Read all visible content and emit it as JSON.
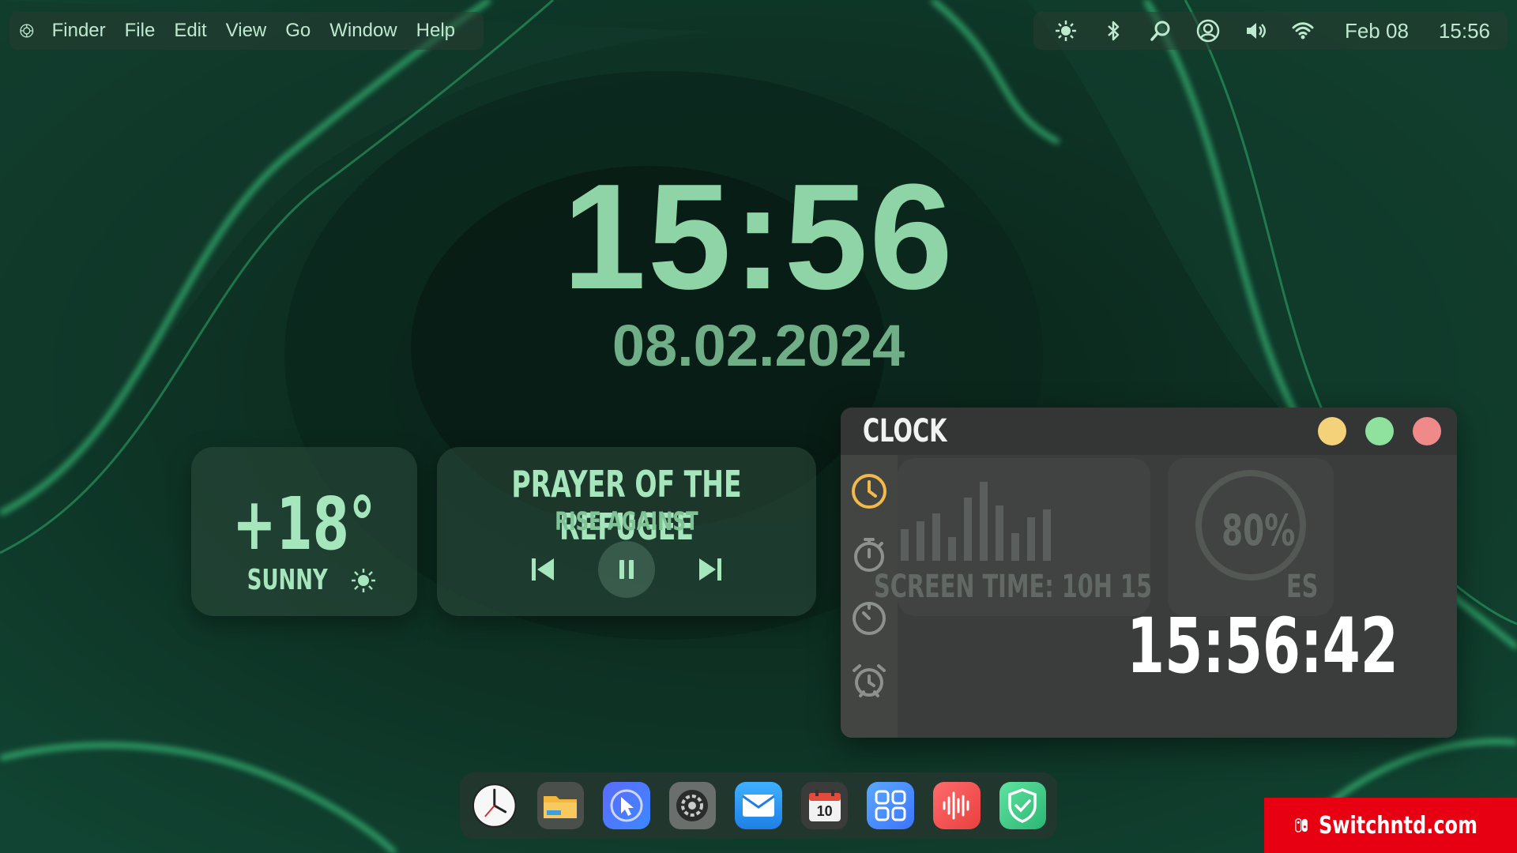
{
  "menubar": {
    "items": [
      "Finder",
      "File",
      "Edit",
      "View",
      "Go",
      "Window",
      "Help"
    ],
    "date": "Feb 08",
    "time": "15:56",
    "status_icons": [
      "brightness-icon",
      "bluetooth-icon",
      "search-icon",
      "user-icon",
      "volume-icon",
      "wifi-icon"
    ]
  },
  "desktop_clock": {
    "time": "15:56",
    "date": "08.02.2024"
  },
  "weather": {
    "temp": "+18°",
    "condition": "SUNNY"
  },
  "player": {
    "title": "PRAYER OF THE REFUGEE",
    "artist": "RISE AGAINST"
  },
  "clock_window": {
    "title": "CLOCK",
    "time": "15:56:42",
    "background_widget_text": "SCREEN TIME: 10H 15",
    "background_widget_pct": "80%",
    "background_widget_suffix": "ES",
    "sidebar": [
      "clock-icon",
      "stopwatch-icon",
      "timer-icon",
      "alarm-icon"
    ]
  },
  "dock": {
    "apps": [
      "clock-app-icon",
      "files-app-icon",
      "browser-app-icon",
      "settings-app-icon",
      "mail-app-icon",
      "calendar-app-icon",
      "apps-grid-icon",
      "voice-memo-icon",
      "security-app-icon"
    ],
    "calendar_day": "10"
  },
  "watermark": {
    "text": "Switchntd.com"
  },
  "colors": {
    "accent_green": "#8fd4a7",
    "active_sidebar": "#f3b94a",
    "close": "#f08a8a",
    "minimize": "#f3d27a",
    "maximize": "#8fe29e"
  }
}
